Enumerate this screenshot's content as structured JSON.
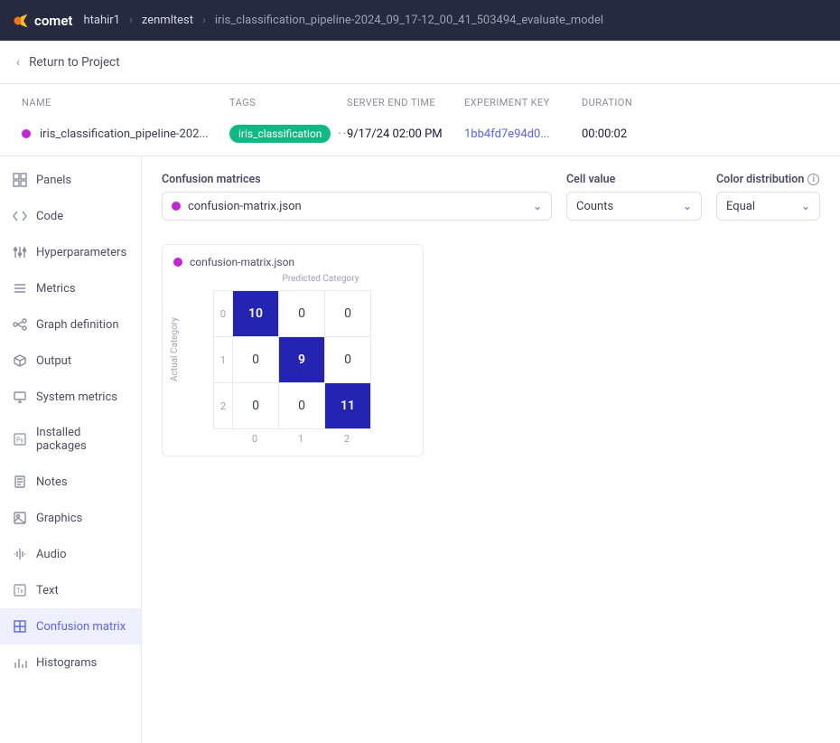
{
  "topbar": {
    "logo": "comet",
    "crumbs": [
      "htahir1",
      "zenmltest",
      "iris_classification_pipeline-2024_09_17-12_00_41_503494_evaluate_model"
    ]
  },
  "return_label": "Return to Project",
  "columns": {
    "name": "NAME",
    "tags": "TAGS",
    "server_end": "SERVER END TIME",
    "exp_key": "EXPERIMENT KEY",
    "duration": "DURATION"
  },
  "experiment": {
    "name": "iris_classification_pipeline-202...",
    "tag": "iris_classification",
    "tag_more": "···",
    "server_end": "9/17/24 02:00 PM",
    "key": "1bb4fd7e94d0...",
    "duration": "00:00:02"
  },
  "sidebar": {
    "items": [
      {
        "id": "panels",
        "label": "Panels"
      },
      {
        "id": "code",
        "label": "Code"
      },
      {
        "id": "hyperparameters",
        "label": "Hyperparameters"
      },
      {
        "id": "metrics",
        "label": "Metrics"
      },
      {
        "id": "graph-definition",
        "label": "Graph definition"
      },
      {
        "id": "output",
        "label": "Output"
      },
      {
        "id": "system-metrics",
        "label": "System metrics"
      },
      {
        "id": "installed-packages",
        "label": "Installed packages"
      },
      {
        "id": "notes",
        "label": "Notes"
      },
      {
        "id": "graphics",
        "label": "Graphics"
      },
      {
        "id": "audio",
        "label": "Audio"
      },
      {
        "id": "text",
        "label": "Text"
      },
      {
        "id": "confusion-matrix",
        "label": "Confusion matrix"
      },
      {
        "id": "histograms",
        "label": "Histograms"
      }
    ],
    "active": "confusion-matrix"
  },
  "controls": {
    "matrices_label": "Confusion matrices",
    "matrices_value": "confusion-matrix.json",
    "cell_value_label": "Cell value",
    "cell_value": "Counts",
    "color_dist_label": "Color distribution",
    "color_dist": "Equal"
  },
  "matrix": {
    "title": "confusion-matrix.json",
    "predicted_label": "Predicted Category",
    "actual_label": "Actual Category",
    "row_labels": [
      "0",
      "1",
      "2"
    ],
    "col_labels": [
      "0",
      "1",
      "2"
    ],
    "cells": [
      [
        "10",
        "0",
        "0"
      ],
      [
        "0",
        "9",
        "0"
      ],
      [
        "0",
        "0",
        "11"
      ]
    ]
  },
  "chart_data": {
    "type": "heatmap",
    "title": "confusion-matrix.json",
    "xlabel": "Predicted Category",
    "ylabel": "Actual Category",
    "x_categories": [
      "0",
      "1",
      "2"
    ],
    "y_categories": [
      "0",
      "1",
      "2"
    ],
    "values": [
      [
        10,
        0,
        0
      ],
      [
        0,
        9,
        0
      ],
      [
        0,
        0,
        11
      ]
    ]
  }
}
